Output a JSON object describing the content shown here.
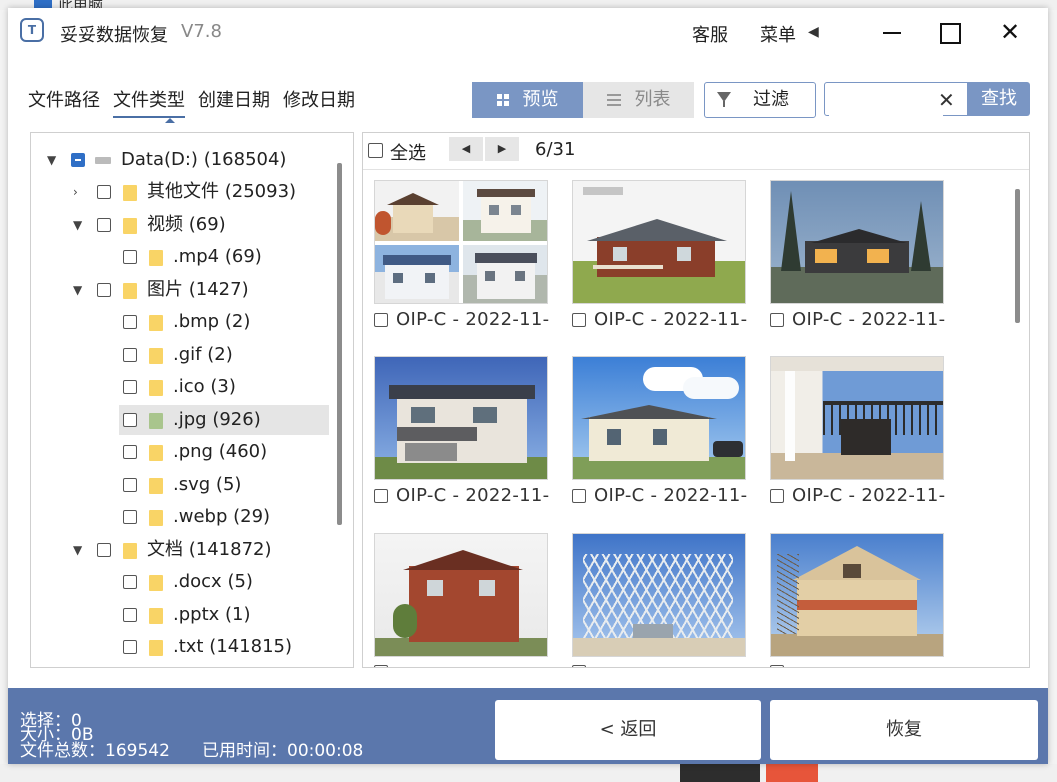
{
  "background": {
    "window_title_fragment": "此电脑"
  },
  "app": {
    "logo": "T",
    "title": "妥妥数据恢复",
    "version": "V7.8",
    "service_label": "客服",
    "menu_label": "菜单",
    "menu_arrow": "◀"
  },
  "tabs": [
    {
      "label": "文件路径"
    },
    {
      "label": "文件类型"
    },
    {
      "label": "创建日期"
    },
    {
      "label": "修改日期"
    }
  ],
  "toolbar": {
    "preview_label": "预览",
    "list_label": "列表",
    "filter_label": "过滤",
    "search_placeholder": "",
    "search_value": "",
    "search_clear": "✕",
    "search_button": "查找"
  },
  "tree": [
    {
      "label": "Data(D:)",
      "count": "(168504)",
      "kind": "drive",
      "expanded": true,
      "checked": "partial"
    },
    {
      "label": "其他文件",
      "count": "(25093)",
      "kind": "folder",
      "expanded": false
    },
    {
      "label": "视频",
      "count": "(69)",
      "kind": "folder",
      "expanded": true
    },
    {
      "label": ".mp4",
      "count": "(69)",
      "kind": "file-type"
    },
    {
      "label": "图片",
      "count": "(1427)",
      "kind": "folder",
      "expanded": true
    },
    {
      "label": ".bmp",
      "count": "(2)",
      "kind": "file-type"
    },
    {
      "label": ".gif",
      "count": "(2)",
      "kind": "file-type"
    },
    {
      "label": ".ico",
      "count": "(3)",
      "kind": "file-type"
    },
    {
      "label": ".jpg",
      "count": "(926)",
      "kind": "file-type",
      "selected": true
    },
    {
      "label": ".png",
      "count": "(460)",
      "kind": "file-type"
    },
    {
      "label": ".svg",
      "count": "(5)",
      "kind": "file-type"
    },
    {
      "label": ".webp",
      "count": "(29)",
      "kind": "file-type"
    },
    {
      "label": "文档",
      "count": "(141872)",
      "kind": "folder",
      "expanded": true
    },
    {
      "label": ".docx",
      "count": "(5)",
      "kind": "file-type"
    },
    {
      "label": ".pptx",
      "count": "(1)",
      "kind": "file-type"
    },
    {
      "label": ".txt",
      "count": "(141815)",
      "kind": "file-type"
    }
  ],
  "files_header": {
    "select_all": "全选",
    "prev_arrow": "◀",
    "next_arrow": "▶",
    "page": "6/31"
  },
  "files": [
    {
      "name": "OIP-C - 2022-11-"
    },
    {
      "name": "OIP-C - 2022-11-"
    },
    {
      "name": "OIP-C - 2022-11-"
    },
    {
      "name": "OIP-C - 2022-11-"
    },
    {
      "name": "OIP-C - 2022-11-"
    },
    {
      "name": "OIP-C - 2022-11-"
    },
    {
      "name": ""
    },
    {
      "name": ""
    },
    {
      "name": ""
    }
  ],
  "footer": {
    "selected_label": "选择：0",
    "size_label": "大小：0B",
    "total_label": "文件总数：169542",
    "elapsed_label": "已用时间：00:00:08",
    "back_button": "< 返回",
    "restore_button": "恢复"
  },
  "colors": {
    "accent": "#5b77ac",
    "toggle_active": "#7a96c4",
    "folder": "#f9d466",
    "checkbox_active": "#2f6fc6"
  }
}
